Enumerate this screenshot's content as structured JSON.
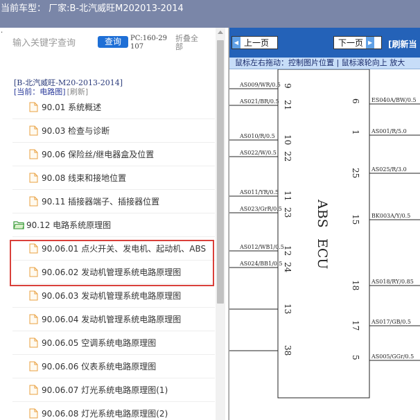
{
  "header": {
    "title": "当前车型：  厂家:B-北汽威旺M202013-2014"
  },
  "left": {
    "dot": "·",
    "search": {
      "placeholder": "输入关键字查询",
      "value": ""
    },
    "query_label": "查询",
    "pc_code": "PC:160-29107",
    "collapse_label": "折叠全部",
    "vehicle": "[B-北汽威旺-M20-2013-2014]",
    "current_prefix": "[当前：电路图]",
    "refresh_label": "[刷新]",
    "tree": [
      {
        "label": "90.01 系统概述",
        "type": "file"
      },
      {
        "label": "90.03 检查与诊断",
        "type": "file"
      },
      {
        "label": "90.06 保险丝/继电器盒及位置",
        "type": "file"
      },
      {
        "label": "90.08 线束和接地位置",
        "type": "file"
      },
      {
        "label": "90.11 插接器端子、插接器位置",
        "type": "file"
      },
      {
        "label": "90.12 电路系统原理图",
        "type": "folder"
      },
      {
        "label": "90.06.01 点火开关、发电机、起动机、ABS",
        "type": "file"
      },
      {
        "label": "90.06.02 发动机管理系统电路原理图",
        "type": "file"
      },
      {
        "label": "90.06.03 发动机管理系统电路原理图",
        "type": "file"
      },
      {
        "label": "90.06.04 发动机管理系统电路原理图",
        "type": "file"
      },
      {
        "label": "90.06.05 空调系统电路原理图",
        "type": "file"
      },
      {
        "label": "90.06.06 仪表系统电路原理图",
        "type": "file"
      },
      {
        "label": "90.06.07 灯光系统电路原理图(1)",
        "type": "file"
      },
      {
        "label": "90.06.08 灯光系统电路原理图(2)",
        "type": "file"
      }
    ]
  },
  "right": {
    "prev_label": "上一页",
    "next_label": "下一页",
    "refresh_label": "[刷新当",
    "hint": "鼠标左右拖动：控制图片位置 | 鼠标滚轮向上 放大",
    "ecu": {
      "line1": "ABS",
      "line2": "ECU"
    },
    "left_wires": [
      {
        "label": "AS009/WR/0.5",
        "pin": "9"
      },
      {
        "label": "AS021/BR/0.5",
        "pin": "21"
      },
      {
        "label": "AS010/R/0.5",
        "pin": "10"
      },
      {
        "label": "AS022/W/0.5",
        "pin": "22"
      },
      {
        "label": "AS011/YR/0.5",
        "pin": "11"
      },
      {
        "label": "AS023/GrR/0.5",
        "pin": "23"
      },
      {
        "label": "AS012/WB1/0.5",
        "pin": "12"
      },
      {
        "label": "AS024/BB1/0.5",
        "pin": "24"
      },
      {
        "label": "",
        "pin": "13"
      },
      {
        "label": "",
        "pin": "38"
      }
    ],
    "right_wires": [
      {
        "label": "ES040A/BW/0.5",
        "pin": "6"
      },
      {
        "label": "AS001/R/5.0",
        "pin": "1"
      },
      {
        "label": "AS025/R/3.0",
        "pin": "25"
      },
      {
        "label": "BK003A/Y/0.5",
        "pin": "15"
      },
      {
        "label": "AS018/RY/0.85",
        "pin": "18"
      },
      {
        "label": "AS017/GB/0.5",
        "pin": "17"
      },
      {
        "label": "AS005/GGr/0.5",
        "pin": "5"
      }
    ]
  },
  "colors": {
    "header_bg": "#7a86a8",
    "accent": "#1e6fd6",
    "toolbar": "#2462b8",
    "highlight": "#d9403a"
  }
}
